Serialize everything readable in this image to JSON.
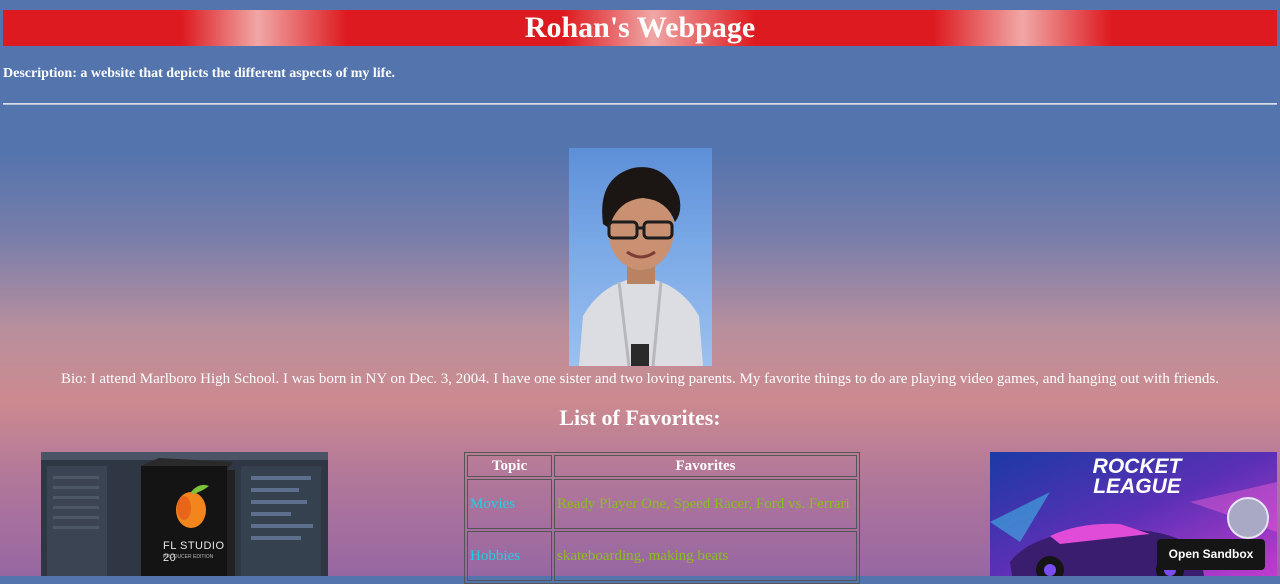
{
  "header": {
    "title": "Rohan's Webpage"
  },
  "description": "Description: a website that depicts the different aspects of my life.",
  "bio": "Bio: I attend Marlboro High School. I was born in NY on Dec. 3, 2004. I have one sister and two loving parents. My favorite things to do are playing video games, and hanging out with friends.",
  "favorites": {
    "title": "List of Favorites:",
    "columns": [
      "Topic",
      "Favorites"
    ],
    "rows": [
      {
        "topic": "Movies",
        "value": "Ready Player One, Speed Racer, Ford vs. Ferrari"
      },
      {
        "topic": "Hobbies",
        "value": "skateboarding, making beats"
      }
    ]
  },
  "images": {
    "left": {
      "product_name": "FL STUDIO 20",
      "edition": "PRODUCER EDITION"
    },
    "right": {
      "title_line1": "ROCKET",
      "title_line2": "LEAGUE"
    }
  },
  "sandbox_button": "Open Sandbox",
  "colors": {
    "header_red": "#dd1a1f",
    "topic_link": "#1fd0e3",
    "favorite_text": "#8abe1c"
  }
}
